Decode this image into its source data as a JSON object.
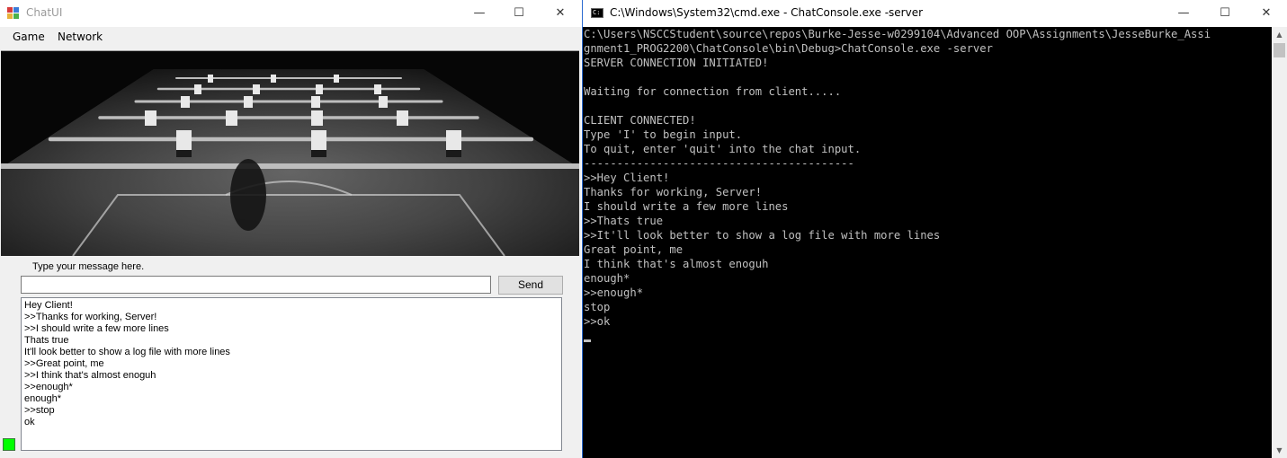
{
  "chatui": {
    "title": "ChatUI",
    "controls": {
      "minimize": "—",
      "maximize": "☐",
      "close": "✕"
    },
    "menu": [
      "Game",
      "Network"
    ],
    "image_description_icon": "foosball-table-photo",
    "prompt_label": "Type your message here.",
    "message_input_value": "",
    "send_label": "Send",
    "log": [
      "Hey Client!",
      ">>Thanks for working, Server!",
      ">>I should write a few more lines",
      "Thats true",
      "It'll look better to show a log file with more lines",
      ">>Great point, me",
      ">>I think that's almost enoguh",
      ">>enough*",
      "enough*",
      ">>stop",
      "ok"
    ],
    "status_color": "#00ff00"
  },
  "cmd": {
    "title": "C:\\Windows\\System32\\cmd.exe - ChatConsole.exe  -server",
    "controls": {
      "minimize": "—",
      "maximize": "☐",
      "close": "✕"
    },
    "lines": [
      "C:\\Users\\NSCCStudent\\source\\repos\\Burke-Jesse-w0299104\\Advanced OOP\\Assignments\\JesseBurke_Assi",
      "gnment1_PROG2200\\ChatConsole\\bin\\Debug>ChatConsole.exe -server",
      "SERVER CONNECTION INITIATED!",
      "",
      "Waiting for connection from client.....",
      "",
      "CLIENT CONNECTED!",
      "Type 'I' to begin input.",
      "To quit, enter 'quit' into the chat input.",
      "-----------------------------------------",
      ">>Hey Client!",
      "Thanks for working, Server!",
      "I should write a few more lines",
      ">>Thats true",
      ">>It'll look better to show a log file with more lines",
      "Great point, me",
      "I think that's almost enoguh",
      "enough*",
      ">>enough*",
      "stop",
      ">>ok"
    ]
  }
}
